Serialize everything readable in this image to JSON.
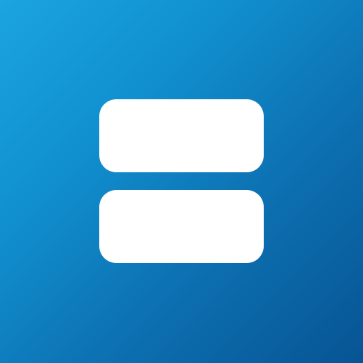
{
  "icon": {
    "name": "two-stacked-rounded-bars-icon",
    "colors": {
      "background_gradient": [
        "#1ba4e0",
        "#1191d0",
        "#0d72b3",
        "#075493"
      ],
      "glyph": "#ffffff"
    }
  }
}
